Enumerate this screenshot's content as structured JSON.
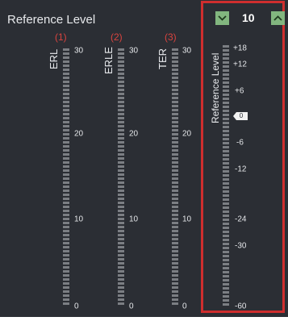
{
  "title": "Reference Level",
  "meters": [
    {
      "num": "(1)",
      "label": "ERL",
      "ticks": [
        "30",
        "20",
        "10",
        "0"
      ]
    },
    {
      "num": "(2)",
      "label": "ERLE",
      "ticks": [
        "30",
        "20",
        "10",
        "0"
      ]
    },
    {
      "num": "(3)",
      "label": "TER",
      "ticks": [
        "30",
        "20",
        "10",
        "0"
      ]
    }
  ],
  "reference": {
    "label": "Reference Level",
    "value": "10",
    "marker_value": "0",
    "ticks": [
      "+18",
      "+12",
      "+6",
      "-6",
      "-12",
      "-24",
      "-30",
      "-60"
    ]
  },
  "controls": {
    "decrement_icon": "chevron-down-icon",
    "increment_icon": "chevron-up-icon"
  },
  "colors": {
    "panel": "#2b2e34",
    "segment": "#7b7e83",
    "button": "#82b67f",
    "highlight": "#cf2e2e",
    "index": "#d9443f"
  }
}
